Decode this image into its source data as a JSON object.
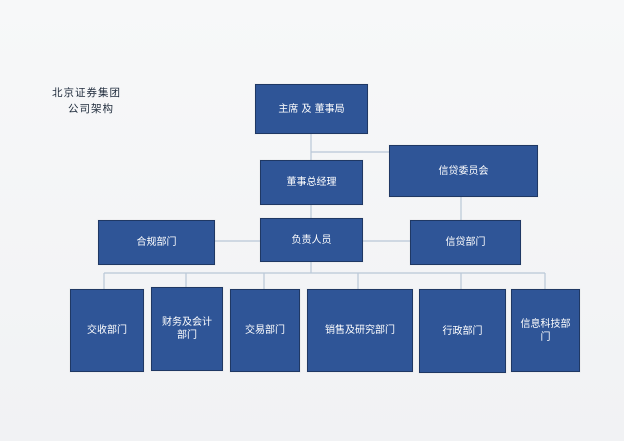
{
  "heading": {
    "line1": "北京证券集团",
    "line2": "公司架构"
  },
  "org": {
    "chairman_board": "主席 及 董事局",
    "credit_committee": "信贷委员会",
    "board_gm": "董事总经理",
    "person_in_charge": "负责人员",
    "compliance": "合规部门",
    "credit_dept": "信贷部门",
    "departments": [
      "交收部门",
      "财务及会计部门",
      "交易部门",
      "销售及研究部门",
      "行政部门",
      "信息科技部门"
    ]
  },
  "colors": {
    "box_fill": "#2f5597",
    "box_border": "#1f3864",
    "connector": "#b9c7d7"
  }
}
